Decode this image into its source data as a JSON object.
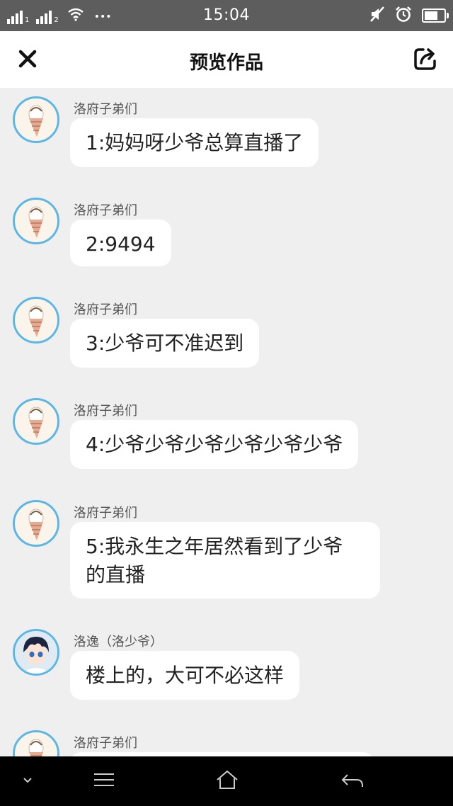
{
  "status_bar": {
    "sim1_label": "1",
    "sim2_label": "2",
    "more_glyph": "•••",
    "time": "15:04",
    "battery_level": 0.6
  },
  "navbar": {
    "title": "预览作品",
    "close_icon": "close-icon",
    "share_icon": "share-icon"
  },
  "messages": [
    {
      "sender": "洛府子弟们",
      "text": "1:妈妈呀少爷总算直播了",
      "avatar": "ice-cream-avatar"
    },
    {
      "sender": "洛府子弟们",
      "text": "2:9494",
      "avatar": "ice-cream-avatar"
    },
    {
      "sender": "洛府子弟们",
      "text": "3:少爷可不准迟到",
      "avatar": "ice-cream-avatar"
    },
    {
      "sender": "洛府子弟们",
      "text": "4:少爷少爷少爷少爷少爷少爷",
      "avatar": "ice-cream-avatar"
    },
    {
      "sender": "洛府子弟们",
      "text_line1": "5:我永生之年居然看到了少爷",
      "text_line2": "的直播",
      "avatar": "ice-cream-avatar"
    },
    {
      "sender": "洛逸（洛少爷）",
      "text": "楼上的，大可不必这样",
      "avatar": "anime-boy-avatar"
    },
    {
      "sender": "洛府子弟们",
      "avatar": "ice-cream-avatar"
    }
  ],
  "system_nav": {
    "icons": [
      "chevron-down-icon",
      "menu-icon",
      "home-icon",
      "back-icon"
    ]
  },
  "colors": {
    "status_bar_bg": "#5d5d5d",
    "chat_bg": "#efefef",
    "avatar_ring": "#5bb8e6"
  }
}
